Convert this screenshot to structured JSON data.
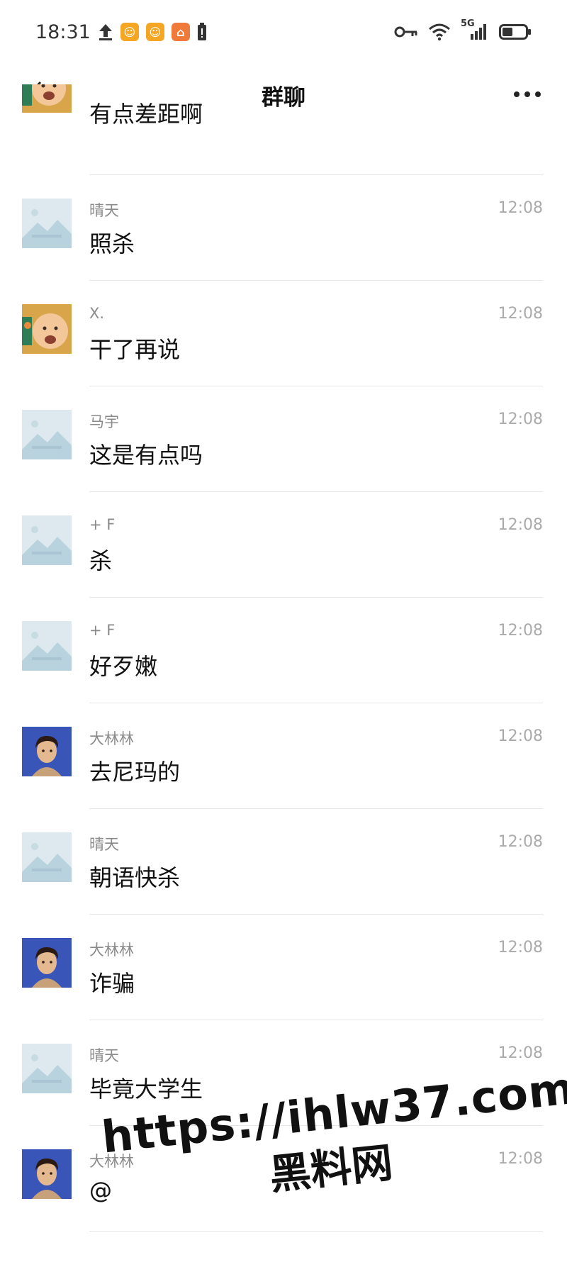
{
  "status_bar": {
    "time": "18:31",
    "network": "5G",
    "icons": [
      "upload-arrow-icon",
      "app-badge-icon",
      "app-badge-icon",
      "app-badge-icon",
      "battery-saver-icon",
      "key-icon",
      "wifi-icon",
      "signal-icon",
      "battery-icon"
    ]
  },
  "header": {
    "title": "群聊",
    "back_icon": "chevron-left-icon",
    "more_icon": "more-dots-icon"
  },
  "messages": [
    {
      "sender": "",
      "time": "",
      "text": "有点差距啊",
      "avatar": "baby"
    },
    {
      "sender": "晴天",
      "time": "12:08",
      "text": "照杀",
      "avatar": "placeholder"
    },
    {
      "sender": "X.",
      "time": "12:08",
      "text": "干了再说",
      "avatar": "baby"
    },
    {
      "sender": "马宇",
      "time": "12:08",
      "text": "这是有点吗",
      "avatar": "placeholder"
    },
    {
      "sender": "+ F",
      "time": "12:08",
      "text": "杀",
      "avatar": "placeholder"
    },
    {
      "sender": "+ F",
      "time": "12:08",
      "text": "好歹嫩",
      "avatar": "placeholder"
    },
    {
      "sender": "大林林",
      "time": "12:08",
      "text": "去尼玛的",
      "avatar": "man"
    },
    {
      "sender": "晴天",
      "time": "12:08",
      "text": "朝语快杀",
      "avatar": "placeholder"
    },
    {
      "sender": "大林林",
      "time": "12:08",
      "text": "诈骗",
      "avatar": "man"
    },
    {
      "sender": "晴天",
      "time": "12:08",
      "text": "毕竟大学生",
      "avatar": "placeholder"
    },
    {
      "sender": "大林林",
      "time": "12:08",
      "text": "@",
      "avatar": "man"
    }
  ],
  "watermark": {
    "url": "https://ihlw37.com",
    "name": "黑料网"
  },
  "colors": {
    "placeholder_bg": "#dde9ee",
    "placeholder_mountain": "#b9d3de",
    "portrait_bg": "#3a55b8"
  }
}
